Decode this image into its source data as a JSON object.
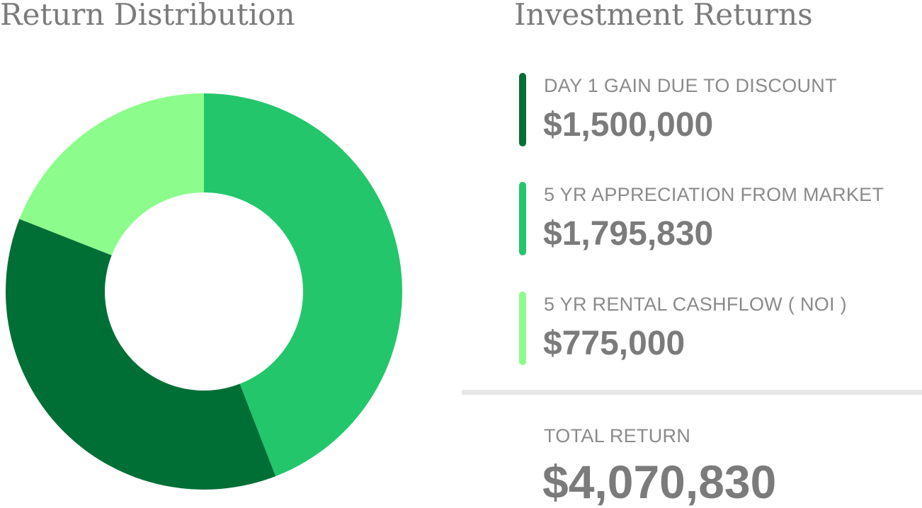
{
  "left_title": "Return Distribution",
  "right_title": "Investment Returns",
  "chart_data": {
    "type": "pie",
    "categories": [
      "DAY 1 GAIN DUE TO DISCOUNT",
      "5 YR APPRECIATION FROM MARKET",
      "5 YR RENTAL CASHFLOW ( NOI )"
    ],
    "values": [
      1500000,
      1795830,
      775000
    ],
    "colors": [
      "#006f36",
      "#24c66c",
      "#8cfd8c"
    ],
    "hole": "donut",
    "start": "top",
    "direction": "clockwise"
  },
  "returns": [
    {
      "label": "DAY 1 GAIN DUE TO DISCOUNT",
      "value": "$1,500,000",
      "color": "#006f36"
    },
    {
      "label": "5 YR APPRECIATION FROM MARKET",
      "value": "$1,795,830",
      "color": "#24c66c"
    },
    {
      "label": "5 YR RENTAL CASHFLOW ( NOI )",
      "value": "$775,000",
      "color": "#8cfd8c"
    }
  ],
  "total": {
    "label": "TOTAL RETURN",
    "value": "$4,070,830"
  }
}
